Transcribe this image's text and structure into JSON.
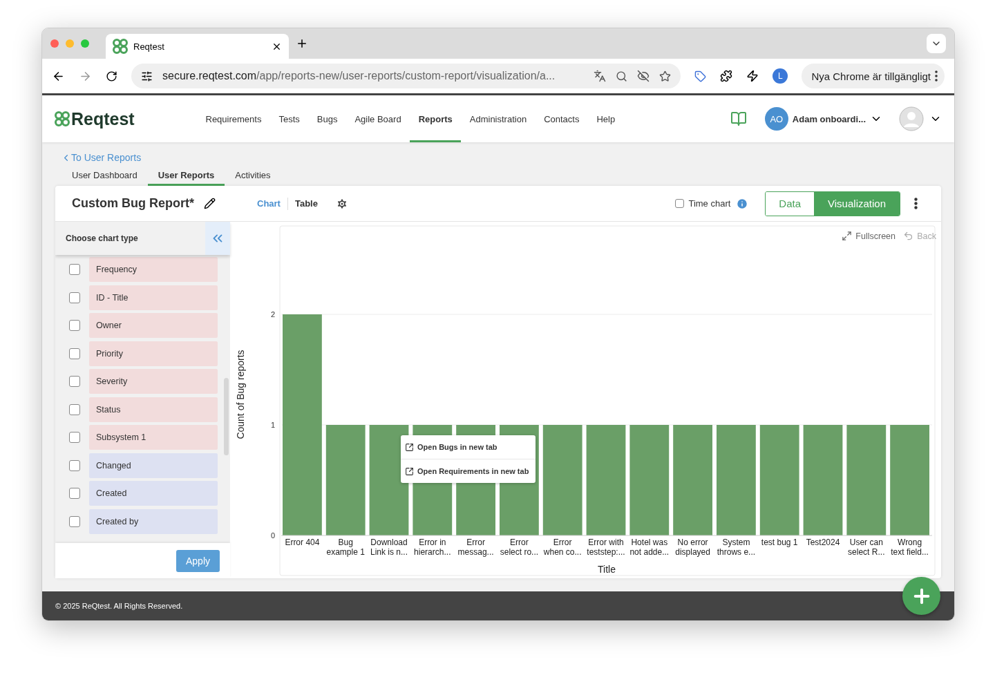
{
  "browser": {
    "tab_title": "Reqtest",
    "address_host": "secure.reqtest.com",
    "address_path": "/app/reports-new/user-reports/custom-report/visualization/a...",
    "profile_initial": "L",
    "update_button": "Nya Chrome är tillgängligt"
  },
  "header": {
    "logo": "Reqtest",
    "nav": [
      {
        "label": "Requirements",
        "selected": false
      },
      {
        "label": "Tests",
        "selected": false
      },
      {
        "label": "Bugs",
        "selected": false
      },
      {
        "label": "Agile Board",
        "selected": false
      },
      {
        "label": "Reports",
        "selected": true
      },
      {
        "label": "Administration",
        "selected": false
      },
      {
        "label": "Contacts",
        "selected": false
      },
      {
        "label": "Help",
        "selected": false
      }
    ],
    "user_initials": "AO",
    "user_name": "Adam onboardi..."
  },
  "back_link": "To User Reports",
  "subtabs": [
    {
      "label": "User Dashboard",
      "selected": false
    },
    {
      "label": "User Reports",
      "selected": true
    },
    {
      "label": "Activities",
      "selected": false
    }
  ],
  "report": {
    "title": "Custom Bug Report*",
    "view_tabs": [
      {
        "label": "Chart",
        "selected": true
      },
      {
        "label": "Table",
        "selected": false
      }
    ],
    "time_chart": {
      "label": "Time chart",
      "checked": false
    },
    "modes": [
      {
        "label": "Data",
        "selected": false
      },
      {
        "label": "Visualization",
        "selected": true
      }
    ]
  },
  "chart_type_panel": {
    "title": "Choose chart type",
    "fields": [
      {
        "label": "Frequency",
        "checked": false,
        "color": "#f2dcdc"
      },
      {
        "label": "ID - Title",
        "checked": false,
        "color": "#f2dcdc"
      },
      {
        "label": "Owner",
        "checked": false,
        "color": "#f2dcdc"
      },
      {
        "label": "Priority",
        "checked": false,
        "color": "#f2dcdc"
      },
      {
        "label": "Severity",
        "checked": false,
        "color": "#f2dcdc"
      },
      {
        "label": "Status",
        "checked": false,
        "color": "#f2dcdc"
      },
      {
        "label": "Subsystem 1",
        "checked": false,
        "color": "#f2dcdc"
      },
      {
        "label": "Changed",
        "checked": false,
        "color": "#dde1f2"
      },
      {
        "label": "Created",
        "checked": false,
        "color": "#dde1f2"
      },
      {
        "label": "Created by",
        "checked": false,
        "color": "#dde1f2"
      }
    ],
    "apply_button": "Apply"
  },
  "chart_toolbar": [
    {
      "label": "Fullscreen",
      "disabled": false
    },
    {
      "label": "Back",
      "disabled": true
    }
  ],
  "chart_data": {
    "type": "bar",
    "xlabel": "Title",
    "ylabel": "Count of Bug reports",
    "ylim": [
      0,
      2.8
    ],
    "yticks": [
      0,
      1,
      2
    ],
    "categories": [
      "Error 404",
      "Bug\nexample 1",
      "Download\nLink is n...",
      "Error in\nhierarch...",
      "Error\nmessag...",
      "Error\nselect ro...",
      "Error\nwhen co...",
      "Error with\nteststep:...",
      "Hotel was\nnot adde...",
      "No error\ndisplayed",
      "System\nthrows e...",
      "test bug 1",
      "Test2024",
      "User can\nselect R...",
      "Wrong\ntext field..."
    ],
    "series": [
      {
        "color": "#6a9f67",
        "values": [
          2,
          1,
          1,
          1,
          1,
          1,
          1,
          1,
          1,
          1,
          1,
          1,
          1,
          1,
          1
        ]
      }
    ]
  },
  "context_menu": [
    "Open Bugs in new tab",
    "Open Requirements in new tab"
  ],
  "footer": "© 2025 ReQtest. All Rights Reserved."
}
